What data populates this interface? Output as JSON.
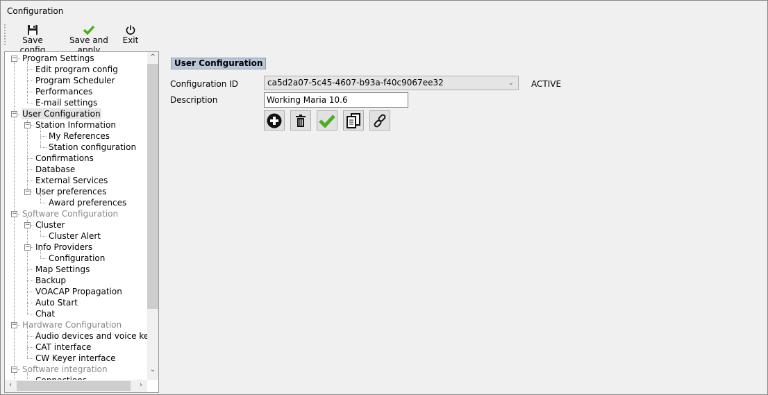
{
  "window": {
    "title": "Configuration"
  },
  "toolbar": {
    "save_config": "Save config",
    "save_and_apply": "Save and apply",
    "exit": "Exit"
  },
  "tree": {
    "items": [
      {
        "label": "Program Settings",
        "level": 0,
        "expander": true
      },
      {
        "label": "Edit program config",
        "level": 1
      },
      {
        "label": "Program Scheduler",
        "level": 1
      },
      {
        "label": "Performances",
        "level": 1
      },
      {
        "label": "E-mail settings",
        "level": 1
      },
      {
        "label": "User Configuration",
        "level": 0,
        "expander": true,
        "selected": true
      },
      {
        "label": "Station Information",
        "level": 1,
        "expander": true
      },
      {
        "label": "My References",
        "level": 2
      },
      {
        "label": "Station configuration",
        "level": 2
      },
      {
        "label": "Confirmations",
        "level": 1
      },
      {
        "label": "Database",
        "level": 1
      },
      {
        "label": "External Services",
        "level": 1
      },
      {
        "label": "User preferences",
        "level": 1,
        "expander": true
      },
      {
        "label": "Award preferences",
        "level": 2
      },
      {
        "label": "Software Configuration",
        "level": 0,
        "expander": true,
        "disabled": true
      },
      {
        "label": "Cluster",
        "level": 1,
        "expander": true
      },
      {
        "label": "Cluster Alert",
        "level": 2
      },
      {
        "label": "Info Providers",
        "level": 1,
        "expander": true
      },
      {
        "label": "Configuration",
        "level": 2
      },
      {
        "label": "Map Settings",
        "level": 1
      },
      {
        "label": "Backup",
        "level": 1
      },
      {
        "label": "VOACAP Propagation",
        "level": 1
      },
      {
        "label": "Auto Start",
        "level": 1
      },
      {
        "label": "Chat",
        "level": 1
      },
      {
        "label": "Hardware Configuration",
        "level": 0,
        "expander": true,
        "disabled": true
      },
      {
        "label": "Audio devices and voice keye",
        "level": 1
      },
      {
        "label": "CAT interface",
        "level": 1
      },
      {
        "label": "CW Keyer interface",
        "level": 1
      },
      {
        "label": "Software integration",
        "level": 0,
        "expander": true,
        "disabled": true
      },
      {
        "label": "Connections",
        "level": 1
      }
    ]
  },
  "panel": {
    "section_title": "User Configuration",
    "config_id_label": "Configuration ID",
    "config_id_value": "ca5d2a07-5c45-4607-b93a-f40c9067ee32",
    "status": "ACTIVE",
    "description_label": "Description",
    "description_value": "Working Maria 10.6",
    "buttons": [
      "add-icon",
      "delete-icon",
      "apply-icon",
      "copy-icon",
      "link-icon"
    ]
  },
  "colors": {
    "section_bg": "#b9c7d8",
    "check_green": "#4caf1e"
  }
}
